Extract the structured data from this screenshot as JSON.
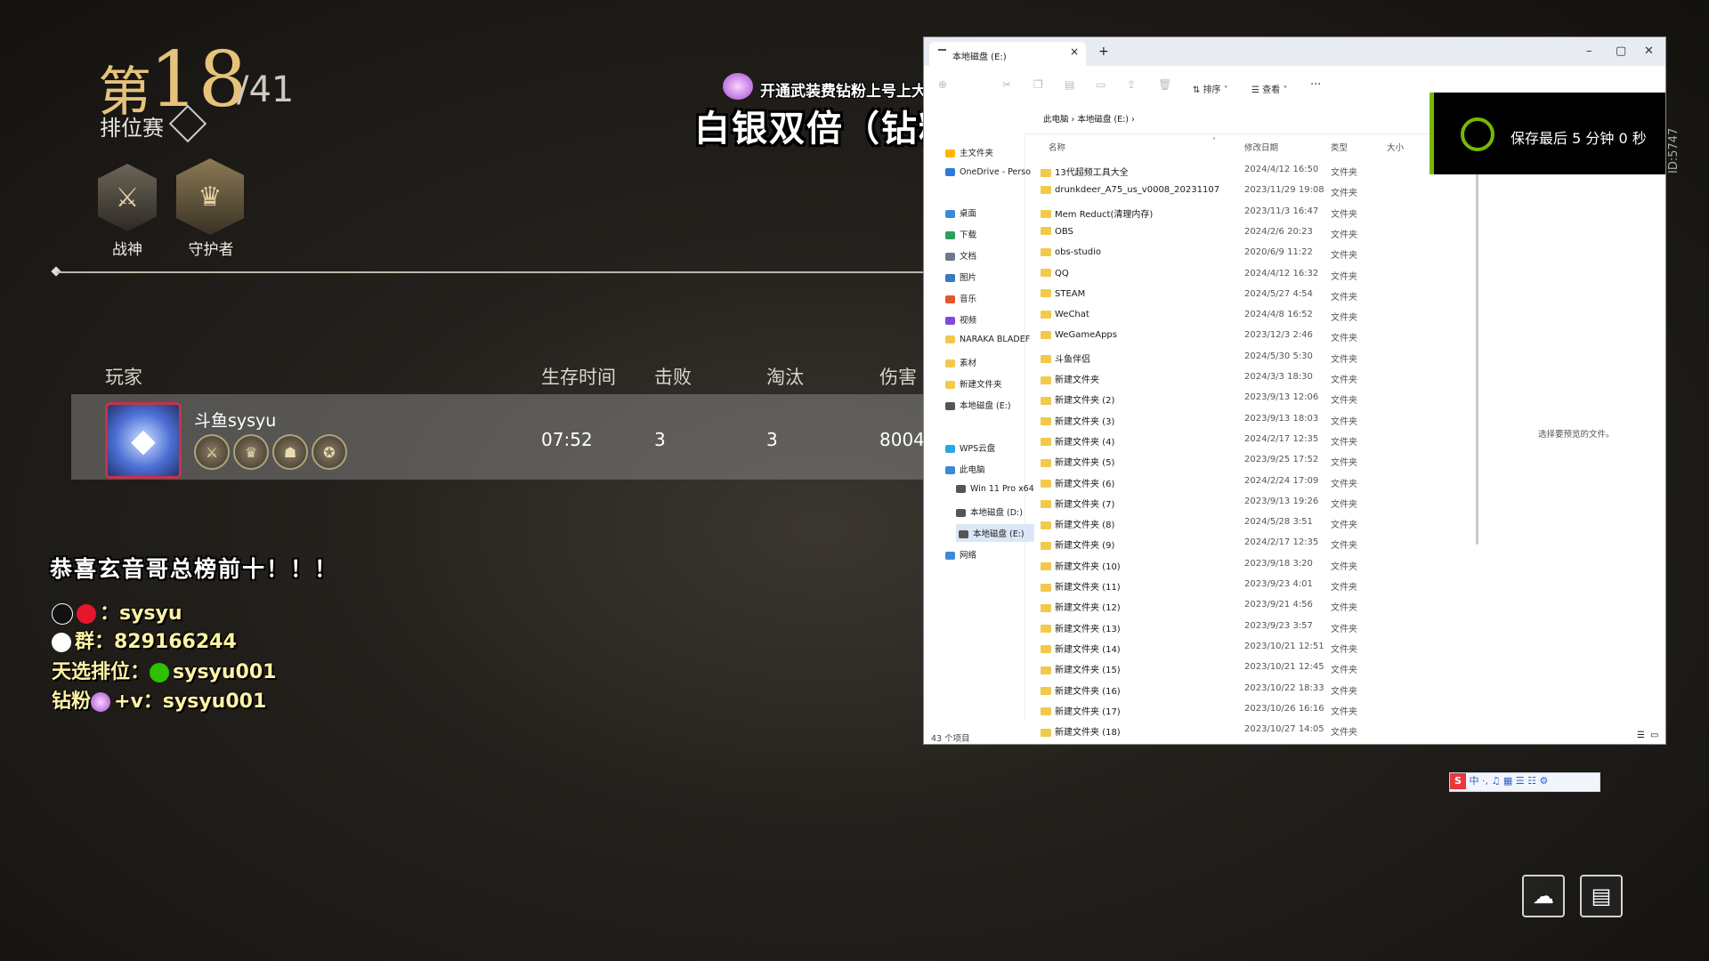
{
  "game": {
    "rank_prefix": "第",
    "rank": "18",
    "rank_total": "/41",
    "mode": "排位赛",
    "badges": [
      {
        "label": "战神",
        "glyph": "⚔"
      },
      {
        "label": "守护者",
        "glyph": "♛"
      }
    ],
    "table_headers": [
      "玩家",
      "生存时间",
      "击败",
      "淘汰",
      "伤害"
    ],
    "player": {
      "name": "斗鱼sysyu",
      "survival": "07:52",
      "kills": "3",
      "eliminations": "3",
      "damage": "8004"
    }
  },
  "overlay": {
    "promo": "开通武装费钻粉上号上大分/上车",
    "title": "白银双倍（钻粉四倍）",
    "congrats": "恭喜玄音哥总榜前十！！！",
    "social": [
      {
        "label": "：sysyu",
        "icon": "douyin-weibo-icon"
      },
      {
        "label": "群：829166244",
        "icon": "qq-icon"
      },
      {
        "label": "天选排位：",
        "value": "sysyu001",
        "icon": "wechat-icon"
      },
      {
        "label": "钻粉",
        "value": "+v：sysyu001",
        "icon": "diamond-icon"
      }
    ]
  },
  "explorer": {
    "tab_title": "本地磁盘 (E:)",
    "toolbar": {
      "sort": "排序",
      "view": "查看"
    },
    "breadcrumb": [
      "此电脑",
      "本地磁盘 (E:)"
    ],
    "nav": [
      {
        "label": "主文件夹",
        "color": "#ffb400"
      },
      {
        "label": "OneDrive - Perso",
        "color": "#2f7ad8"
      },
      {
        "label": "桌面",
        "color": "#3b8ad9"
      },
      {
        "label": "下载",
        "color": "#2aa05a"
      },
      {
        "label": "文档",
        "color": "#6c7a90"
      },
      {
        "label": "图片",
        "color": "#3b78c2"
      },
      {
        "label": "音乐",
        "color": "#e4572e"
      },
      {
        "label": "视频",
        "color": "#7e4bd6"
      },
      {
        "label": "NARAKA  BLADEF",
        "color": "#f2c94c"
      },
      {
        "label": "素材",
        "color": "#f2c94c"
      },
      {
        "label": "新建文件夹",
        "color": "#f2c94c"
      },
      {
        "label": "本地磁盘 (E:)",
        "color": "#555555"
      },
      {
        "label": "WPS云盘",
        "color": "#2aa6e8"
      },
      {
        "label": "此电脑",
        "color": "#3b8ad9"
      },
      {
        "label": "Win 11 Pro x64",
        "color": "#555555"
      },
      {
        "label": "本地磁盘 (D:)",
        "color": "#555555"
      },
      {
        "label": "本地磁盘 (E:)",
        "color": "#555555"
      },
      {
        "label": "网络",
        "color": "#3b8ad9"
      }
    ],
    "columns": [
      "名称",
      "修改日期",
      "类型",
      "大小"
    ],
    "files": [
      [
        "13代超频工具大全",
        "2024/4/12 16:50",
        "文件夹"
      ],
      [
        "drunkdeer_A75_us_v0008_20231107",
        "2023/11/29 19:08",
        "文件夹"
      ],
      [
        "Mem Reduct(清理内存)",
        "2023/11/3 16:47",
        "文件夹"
      ],
      [
        "OBS",
        "2024/2/6 20:23",
        "文件夹"
      ],
      [
        "obs-studio",
        "2020/6/9 11:22",
        "文件夹"
      ],
      [
        "QQ",
        "2024/4/12 16:32",
        "文件夹"
      ],
      [
        "STEAM",
        "2024/5/27 4:54",
        "文件夹"
      ],
      [
        "WeChat",
        "2024/4/8 16:52",
        "文件夹"
      ],
      [
        "WeGameApps",
        "2023/12/3 2:46",
        "文件夹"
      ],
      [
        "斗鱼伴侣",
        "2024/5/30 5:30",
        "文件夹"
      ],
      [
        "新建文件夹",
        "2024/3/3 18:30",
        "文件夹"
      ],
      [
        "新建文件夹 (2)",
        "2023/9/13 12:06",
        "文件夹"
      ],
      [
        "新建文件夹 (3)",
        "2023/9/13 18:03",
        "文件夹"
      ],
      [
        "新建文件夹 (4)",
        "2024/2/17 12:35",
        "文件夹"
      ],
      [
        "新建文件夹 (5)",
        "2023/9/25 17:52",
        "文件夹"
      ],
      [
        "新建文件夹 (6)",
        "2024/2/24 17:09",
        "文件夹"
      ],
      [
        "新建文件夹 (7)",
        "2023/9/13 19:26",
        "文件夹"
      ],
      [
        "新建文件夹 (8)",
        "2024/5/28 3:51",
        "文件夹"
      ],
      [
        "新建文件夹 (9)",
        "2024/2/17 12:35",
        "文件夹"
      ],
      [
        "新建文件夹 (10)",
        "2023/9/18 3:20",
        "文件夹"
      ],
      [
        "新建文件夹 (11)",
        "2023/9/23 4:01",
        "文件夹"
      ],
      [
        "新建文件夹 (12)",
        "2023/9/21 4:56",
        "文件夹"
      ],
      [
        "新建文件夹 (13)",
        "2023/9/23 3:57",
        "文件夹"
      ],
      [
        "新建文件夹 (14)",
        "2023/10/21 12:51",
        "文件夹"
      ],
      [
        "新建文件夹 (15)",
        "2023/10/21 12:45",
        "文件夹"
      ],
      [
        "新建文件夹 (16)",
        "2023/10/22 18:33",
        "文件夹"
      ],
      [
        "新建文件夹 (17)",
        "2023/10/26 16:16",
        "文件夹"
      ],
      [
        "新建文件夹 (18)",
        "2023/10/27 14:05",
        "文件夹"
      ]
    ],
    "preview_empty": "选择要预览的文件。",
    "status": "43 个项目"
  },
  "recorder": {
    "save_text": "保存最后 5 分钟 0 秒"
  },
  "ime": {
    "text": "中 ·, ♫ ▦ ☰ ☷ ⚙"
  },
  "side_id": "ID:5747"
}
